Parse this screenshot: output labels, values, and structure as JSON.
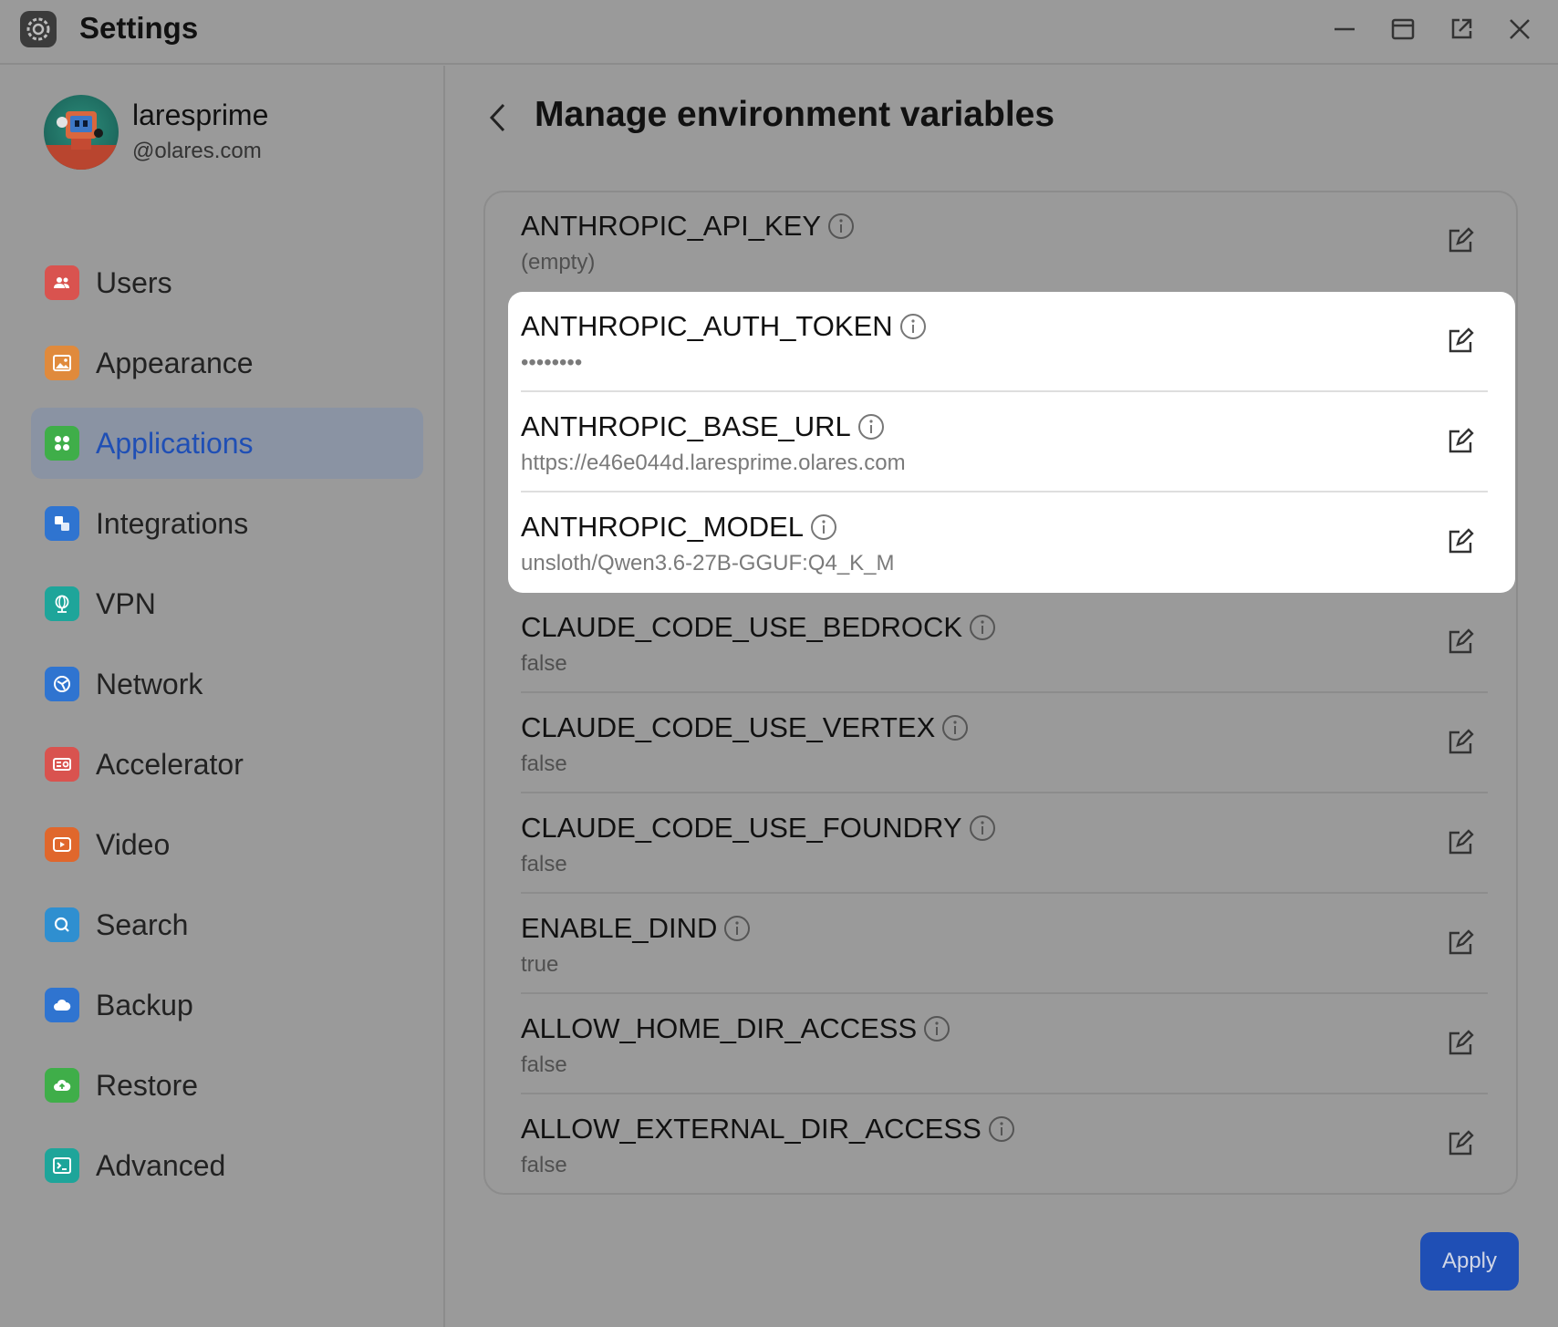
{
  "window": {
    "title": "Settings",
    "controls": [
      "minimize-icon",
      "maximize-icon",
      "pop-out-icon",
      "close-icon"
    ]
  },
  "user": {
    "name": "laresprime",
    "domain": "@olares.com"
  },
  "sidebar": {
    "items": [
      {
        "label": "Users",
        "icon": "users-icon",
        "color": "#d9534f",
        "active": false
      },
      {
        "label": "Appearance",
        "icon": "image-icon",
        "color": "#e08a3c",
        "active": false
      },
      {
        "label": "Applications",
        "icon": "apps-grid-icon",
        "color": "#3fae49",
        "active": true
      },
      {
        "label": "Integrations",
        "icon": "integrations-icon",
        "color": "#2f74d0",
        "active": false
      },
      {
        "label": "VPN",
        "icon": "vpn-globe-icon",
        "color": "#1ea59a",
        "active": false
      },
      {
        "label": "Network",
        "icon": "network-icon",
        "color": "#2f74d0",
        "active": false
      },
      {
        "label": "Accelerator",
        "icon": "accelerator-icon",
        "color": "#d9534f",
        "active": false
      },
      {
        "label": "Video",
        "icon": "video-icon",
        "color": "#e0672c",
        "active": false
      },
      {
        "label": "Search",
        "icon": "search-icon",
        "color": "#2f8fd0",
        "active": false
      },
      {
        "label": "Backup",
        "icon": "cloud-backup-icon",
        "color": "#2f74d0",
        "active": false
      },
      {
        "label": "Restore",
        "icon": "cloud-restore-icon",
        "color": "#3fae49",
        "active": false
      },
      {
        "label": "Advanced",
        "icon": "terminal-icon",
        "color": "#1ea59a",
        "active": false
      }
    ]
  },
  "main": {
    "title": "Manage environment variables",
    "variables": [
      {
        "name": "ANTHROPIC_API_KEY",
        "value": "(empty)"
      },
      {
        "name": "ANTHROPIC_AUTH_TOKEN",
        "value": "••••••••"
      },
      {
        "name": "ANTHROPIC_BASE_URL",
        "value": "https://e46e044d.laresprime.olares.com"
      },
      {
        "name": "ANTHROPIC_MODEL",
        "value": "unsloth/Qwen3.6-27B-GGUF:Q4_K_M"
      },
      {
        "name": "CLAUDE_CODE_USE_BEDROCK",
        "value": "false"
      },
      {
        "name": "CLAUDE_CODE_USE_VERTEX",
        "value": "false"
      },
      {
        "name": "CLAUDE_CODE_USE_FOUNDRY",
        "value": "false"
      },
      {
        "name": "ENABLE_DIND",
        "value": "true"
      },
      {
        "name": "ALLOW_HOME_DIR_ACCESS",
        "value": "false"
      },
      {
        "name": "ALLOW_EXTERNAL_DIR_ACCESS",
        "value": "false"
      }
    ],
    "apply_label": "Apply"
  },
  "colors": {
    "accent": "#1f4fb5",
    "background": "#9a9a9a",
    "highlight": "#ffffff"
  }
}
